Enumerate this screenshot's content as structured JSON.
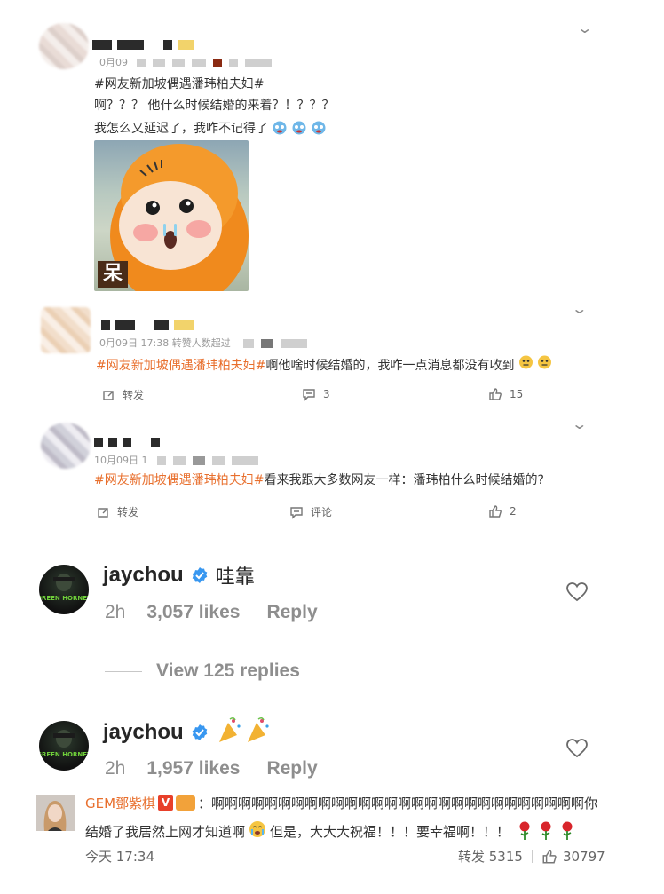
{
  "post1": {
    "meta_partial": "0月09",
    "topic": "#网友新加坡偶遇潘玮柏夫妇#",
    "line1": "啊？？？ 他什么时候结婚的来着？！？？？",
    "line2": "我怎么又延迟了，我咋不记得了",
    "meme_caption": "呆",
    "emoji": "dizzy-face-emoji"
  },
  "post2": {
    "meta": "0月09日 17:38 转赞人数超过",
    "topic": "#网友新加坡偶遇潘玮柏夫妇#",
    "text": "啊他啥时候结婚的，我咋一点消息都没有收到",
    "repost_label": "转发",
    "comment_count": "3",
    "like_count": "15"
  },
  "post3": {
    "meta": "10月09日 1",
    "topic": "#网友新加坡偶遇潘玮柏夫妇#",
    "text": "看来我跟大多数网友一样：潘玮柏什么时候结婚的?",
    "repost_label": "转发",
    "comment_label": "评论",
    "like_count": "2"
  },
  "ig1": {
    "username": "jaychou",
    "comment": "哇靠",
    "time": "2h",
    "likes": "3,057 likes",
    "reply": "Reply",
    "view_replies": "View 125 replies",
    "avatar_text": "GREEN HORNET"
  },
  "ig2": {
    "username": "jaychou",
    "time": "2h",
    "likes": "1,957 likes",
    "reply": "Reply",
    "avatar_text": "GREEN HORNET"
  },
  "final": {
    "name": "GEM鄧紫棋",
    "text_line1": "：啊啊啊啊啊啊啊啊啊啊啊啊啊啊啊啊啊啊啊啊啊啊啊啊啊啊啊啊你",
    "text_line2a": "结婚了我居然上网才知道啊",
    "text_line2b": "但是，大大大祝福！！！要幸福啊！！！",
    "time": "今天 17:34",
    "repost": "转发 5315",
    "likes": "30797"
  },
  "colors": {
    "topic": "#e86f2d",
    "verified": "#3897f0",
    "ig_text": "#262626",
    "ig_muted": "#8e8e8e"
  }
}
